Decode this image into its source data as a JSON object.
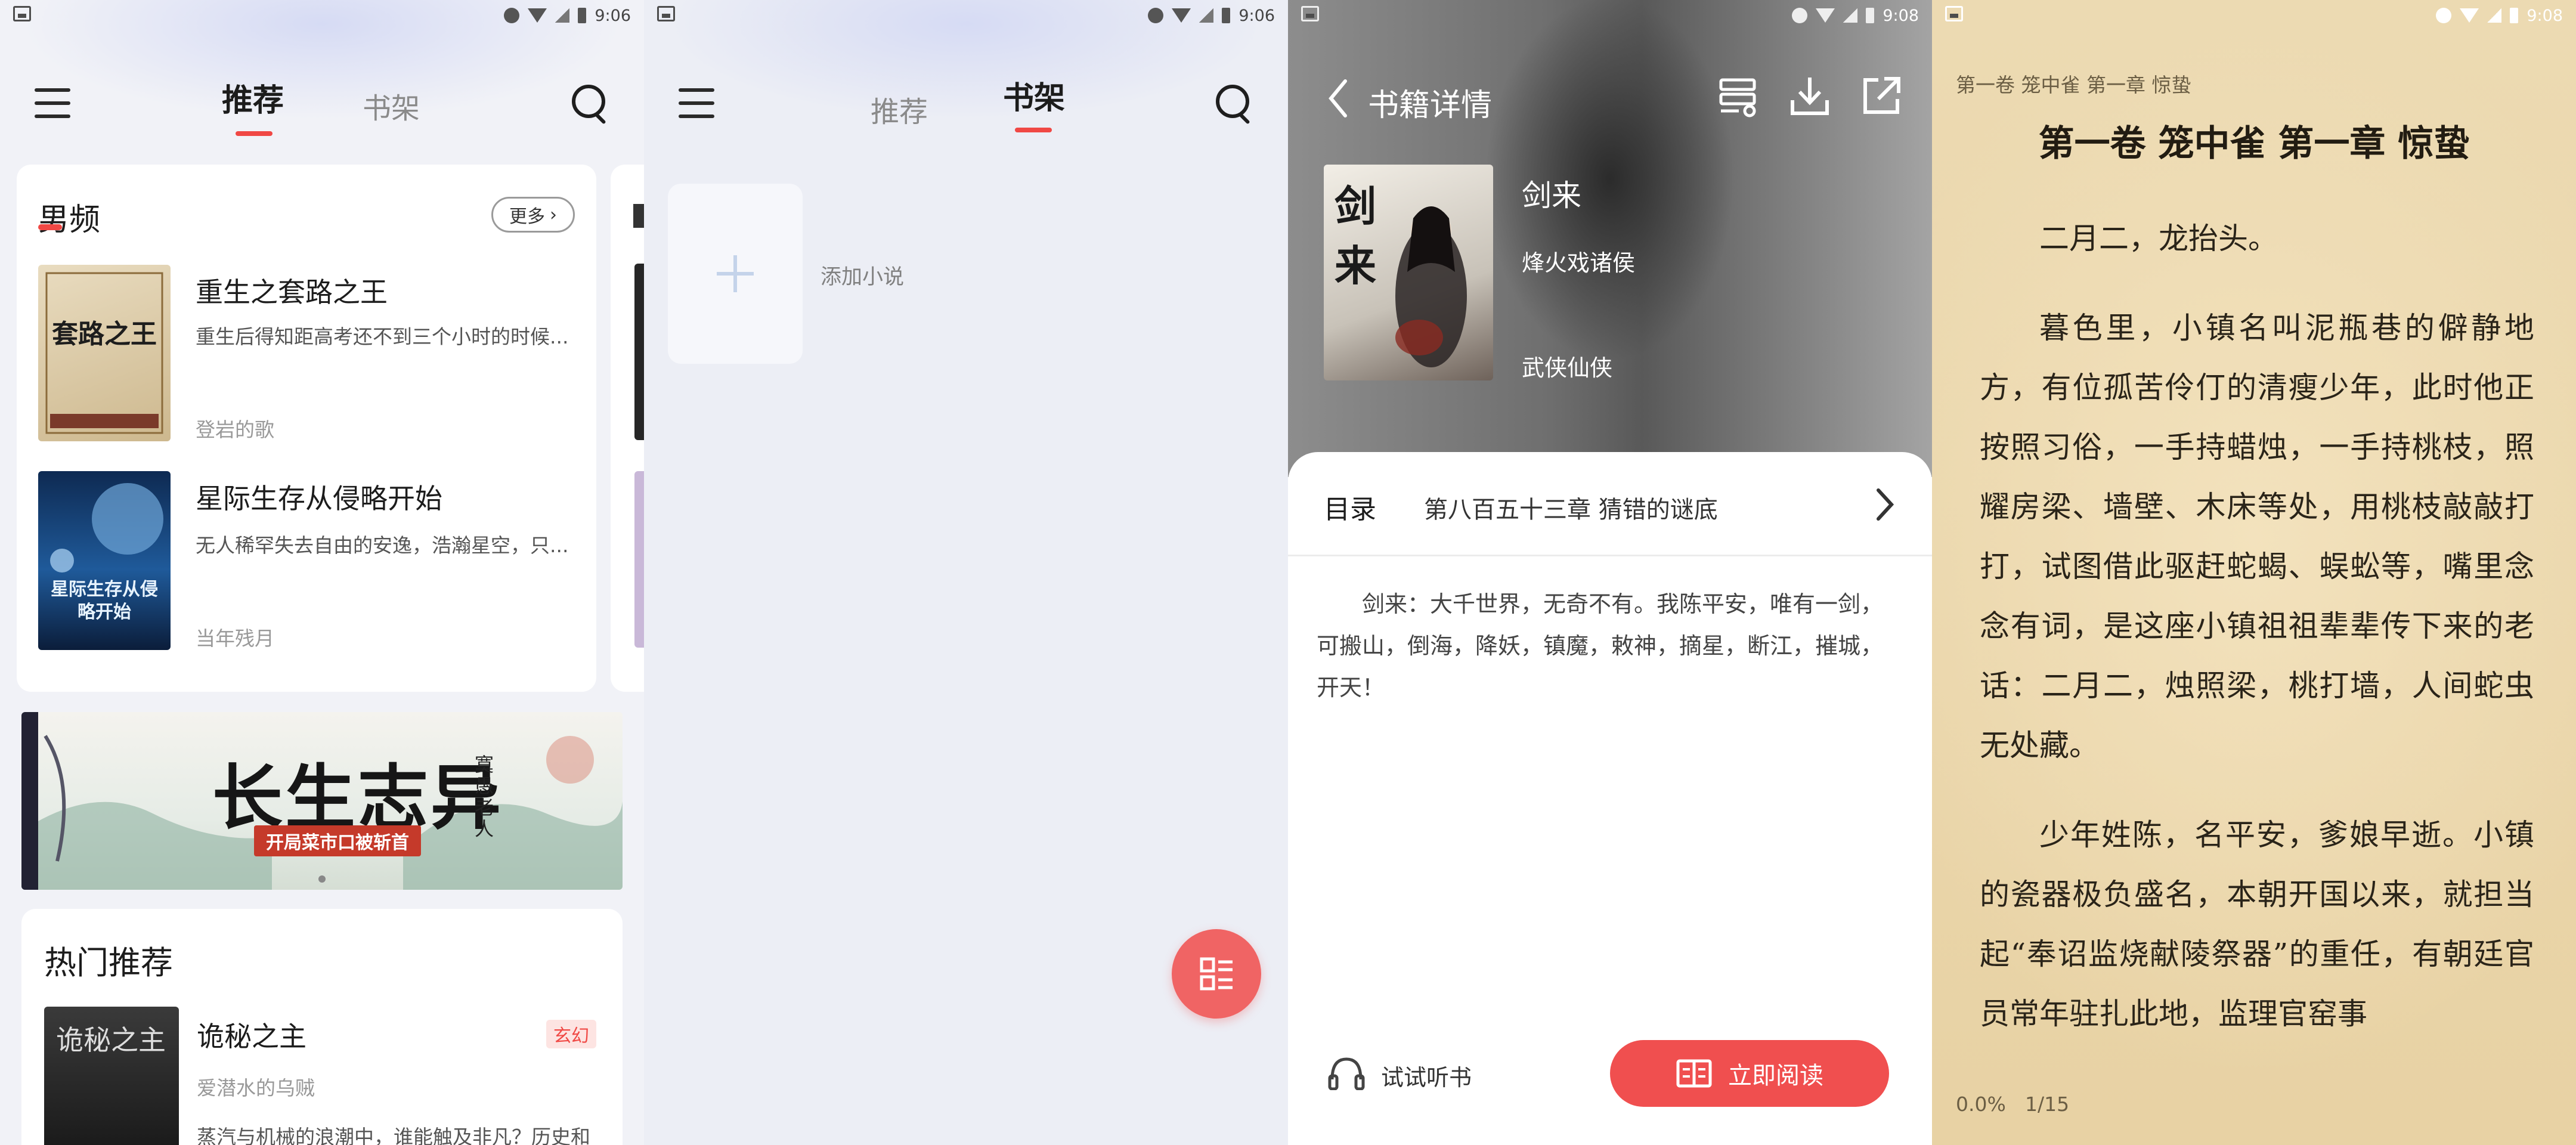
{
  "panel1": {
    "status": {
      "time": "9:06"
    },
    "tabs": [
      {
        "label": "推荐",
        "active": true
      },
      {
        "label": "书架",
        "active": false
      }
    ],
    "male_section": {
      "title": "男频",
      "more_label": "更多",
      "books": [
        {
          "title": "重生之套路之王",
          "desc": "重生后得知距高考还不到三个小时的时候...",
          "author": "登岩的歌",
          "cover_text": "套路之王"
        },
        {
          "title": "星际生存从侵略开始",
          "desc": "无人稀罕失去自由的安逸，浩瀚星空，只...",
          "author": "当年残月",
          "cover_text": "星际生存从侵略开始"
        }
      ]
    },
    "banner": {
      "title": "长生志异",
      "author": "寞愚老人",
      "subtitle": "开局菜市口被斩首"
    },
    "hot_section": {
      "title": "热门推荐",
      "books": [
        {
          "title": "诡秘之主",
          "tag": "玄幻",
          "author": "爱潜水的乌贼",
          "desc": "蒸汽与机械的浪潮中，谁能触及非凡？历史和"
        }
      ]
    }
  },
  "panel2": {
    "status": {
      "time": "9:06"
    },
    "tabs": [
      {
        "label": "推荐",
        "active": false
      },
      {
        "label": "书架",
        "active": true
      }
    ],
    "add_label": "添加小说"
  },
  "panel3": {
    "status": {
      "time": "9:08"
    },
    "header_title": "书籍详情",
    "book": {
      "title": "剑来",
      "author": "烽火戏诸侯",
      "category": "武侠仙侠",
      "cover_text": "剑来"
    },
    "toc_label": "目录",
    "latest_chapter": "第八百五十三章 猜错的谜底",
    "intro": "剑来：大千世界，无奇不有。我陈平安，唯有一剑，可搬山，倒海，降妖，镇魔，敕神，摘星，断江，摧城，开天！",
    "listen_label": "试试听书",
    "read_label": "立即阅读",
    "colors": {
      "accent": "#f04f4f"
    }
  },
  "panel4": {
    "status": {
      "time": "9:08"
    },
    "header_small": "第一卷 笼中雀 第一章 惊蛰",
    "chapter_title": "第一卷 笼中雀 第一章 惊蛰",
    "paragraphs": [
      "二月二，龙抬头。",
      "暮色里，小镇名叫泥瓶巷的僻静地方，有位孤苦伶仃的清瘦少年，此时他正按照习俗，一手持蜡烛，一手持桃枝，照耀房梁、墙壁、木床等处，用桃枝敲敲打打，试图借此驱赶蛇蝎、蜈蚣等，嘴里念念有词，是这座小镇祖祖辈辈传下来的老话：二月二，烛照梁，桃打墙，人间蛇虫无处藏。",
      "少年姓陈，名平安，爹娘早逝。小镇的瓷器极负盛名，本朝开国以来，就担当起“奉诏监烧献陵祭器”的重任，有朝廷官员常年驻扎此地，监理官窑事"
    ],
    "progress": "0.0%",
    "page": "1/15"
  }
}
